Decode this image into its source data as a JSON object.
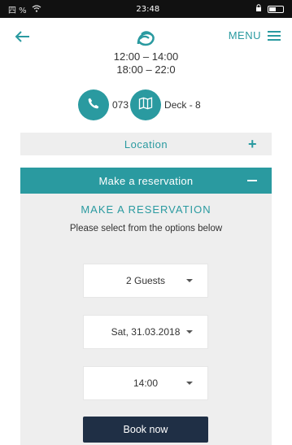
{
  "status": {
    "time": "23:48",
    "left": "四 %",
    "icons": [
      "wifi-icon",
      "battery-icon"
    ]
  },
  "header": {
    "menu_label": "MENU"
  },
  "hours": {
    "line1": "12:00 – 14:00",
    "line2": "18:00 – 22:0"
  },
  "contact": {
    "phone": "073",
    "deck": "Deck - 8"
  },
  "location": {
    "label": "Location",
    "icon": "+"
  },
  "reservation": {
    "bar_label": "Make a reservation",
    "title": "MAKE A RESERVATION",
    "subtitle": "Please select from the options below",
    "guests": "2 Guests",
    "date": "Sat, 31.03.2018",
    "time": "14:00",
    "book_label": "Book now"
  },
  "colors": {
    "teal": "#2a9aa0",
    "dark_navy": "#1f2f45",
    "panel": "#eeeeee"
  }
}
